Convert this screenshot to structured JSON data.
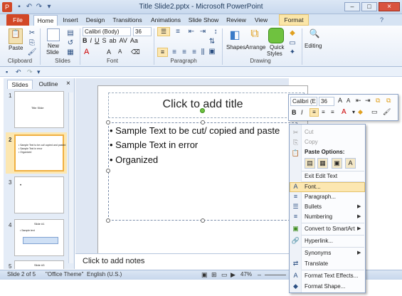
{
  "window": {
    "title": "Title Slide2.pptx - Microsoft PowerPoint"
  },
  "ribbon": {
    "file_label": "File",
    "tabs": [
      "Home",
      "Insert",
      "Design",
      "Transitions",
      "Animations",
      "Slide Show",
      "Review",
      "View"
    ],
    "format_tab": "Format",
    "groups": {
      "clipboard": "Clipboard",
      "slides": "Slides",
      "font": "Font",
      "paragraph": "Paragraph",
      "drawing": "Drawing",
      "editing": "Editing"
    },
    "buttons": {
      "paste": "Paste",
      "new_slide": "New",
      "new_slide2": "Slide",
      "shapes": "Shapes",
      "arrange": "Arrange",
      "quick": "Quick",
      "styles": "Styles",
      "editing": "Editing"
    },
    "font_name": "Calibri (Body)",
    "font_size": "36"
  },
  "panel": {
    "tabs": [
      "Slides",
      "Outline"
    ],
    "close": "×",
    "thumbs": [
      {
        "num": "1",
        "text": "Title Slide"
      },
      {
        "num": "2",
        "lines": [
          "• Sample Text to be cut/ copied and pasted",
          "• Sample Text in error",
          "• Organized"
        ]
      },
      {
        "num": "3",
        "text": "•"
      },
      {
        "num": "4",
        "title": "Slide #1",
        "text": "• Sample text"
      },
      {
        "num": "5",
        "text": "Slide #3"
      }
    ]
  },
  "slide": {
    "title_placeholder": "Click to add title",
    "bullets": [
      "Sample Text to be cut/ copied and paste",
      "Sample Text in error",
      "Organized"
    ]
  },
  "notes_placeholder": "Click to add notes",
  "status": {
    "slide": "Slide 2 of 5",
    "theme": "\"Office Theme\"",
    "language": "English (U.S.)",
    "zoom": "47%"
  },
  "mini_toolbar": {
    "font": "Calibri (E",
    "size": "36"
  },
  "context_menu": {
    "cut": "Cut",
    "copy": "Copy",
    "paste_options": "Paste Options:",
    "exit_edit": "Exit Edit Text",
    "font": "Font...",
    "paragraph": "Paragraph...",
    "bullets": "Bullets",
    "numbering": "Numbering",
    "convert": "Convert to SmartArt",
    "hyperlink": "Hyperlink...",
    "synonyms": "Synonyms",
    "translate": "Translate",
    "format_text": "Format Text Effects...",
    "format_shape": "Format Shape..."
  }
}
